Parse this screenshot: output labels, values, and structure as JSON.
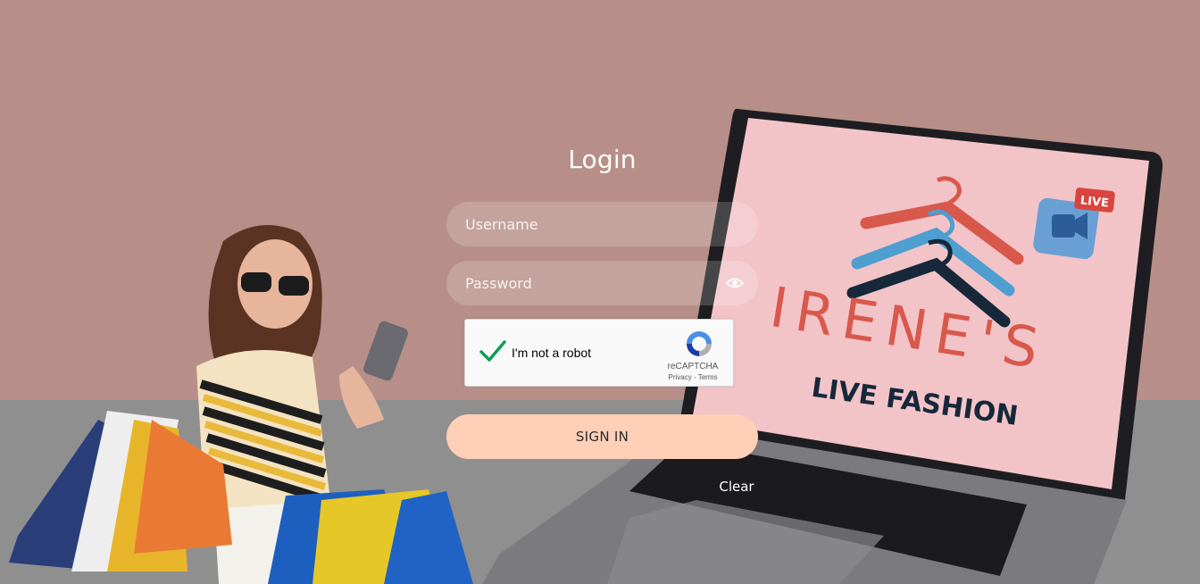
{
  "page": {
    "title": "Login",
    "username_placeholder": "Username",
    "password_placeholder": "Password"
  },
  "captcha": {
    "label": "I'm not a robot",
    "brand": "reCAPTCHA",
    "privacy": "Privacy",
    "separator": " - ",
    "terms": "Terms",
    "checked": true
  },
  "actions": {
    "signin_label": "SIGN IN",
    "clear_label": "Clear"
  },
  "branding": {
    "line1": "IRENE'S",
    "line2": "LIVE FASHION",
    "badge": "LIVE"
  },
  "colors": {
    "wall": "#b78f88",
    "desk": "#8f8f8f",
    "signin_button": "#ffcfb8",
    "check_green": "#0f9d58",
    "brand_red": "#d9584c",
    "brand_blue": "#4e9ecf",
    "brand_navy": "#16283a"
  }
}
